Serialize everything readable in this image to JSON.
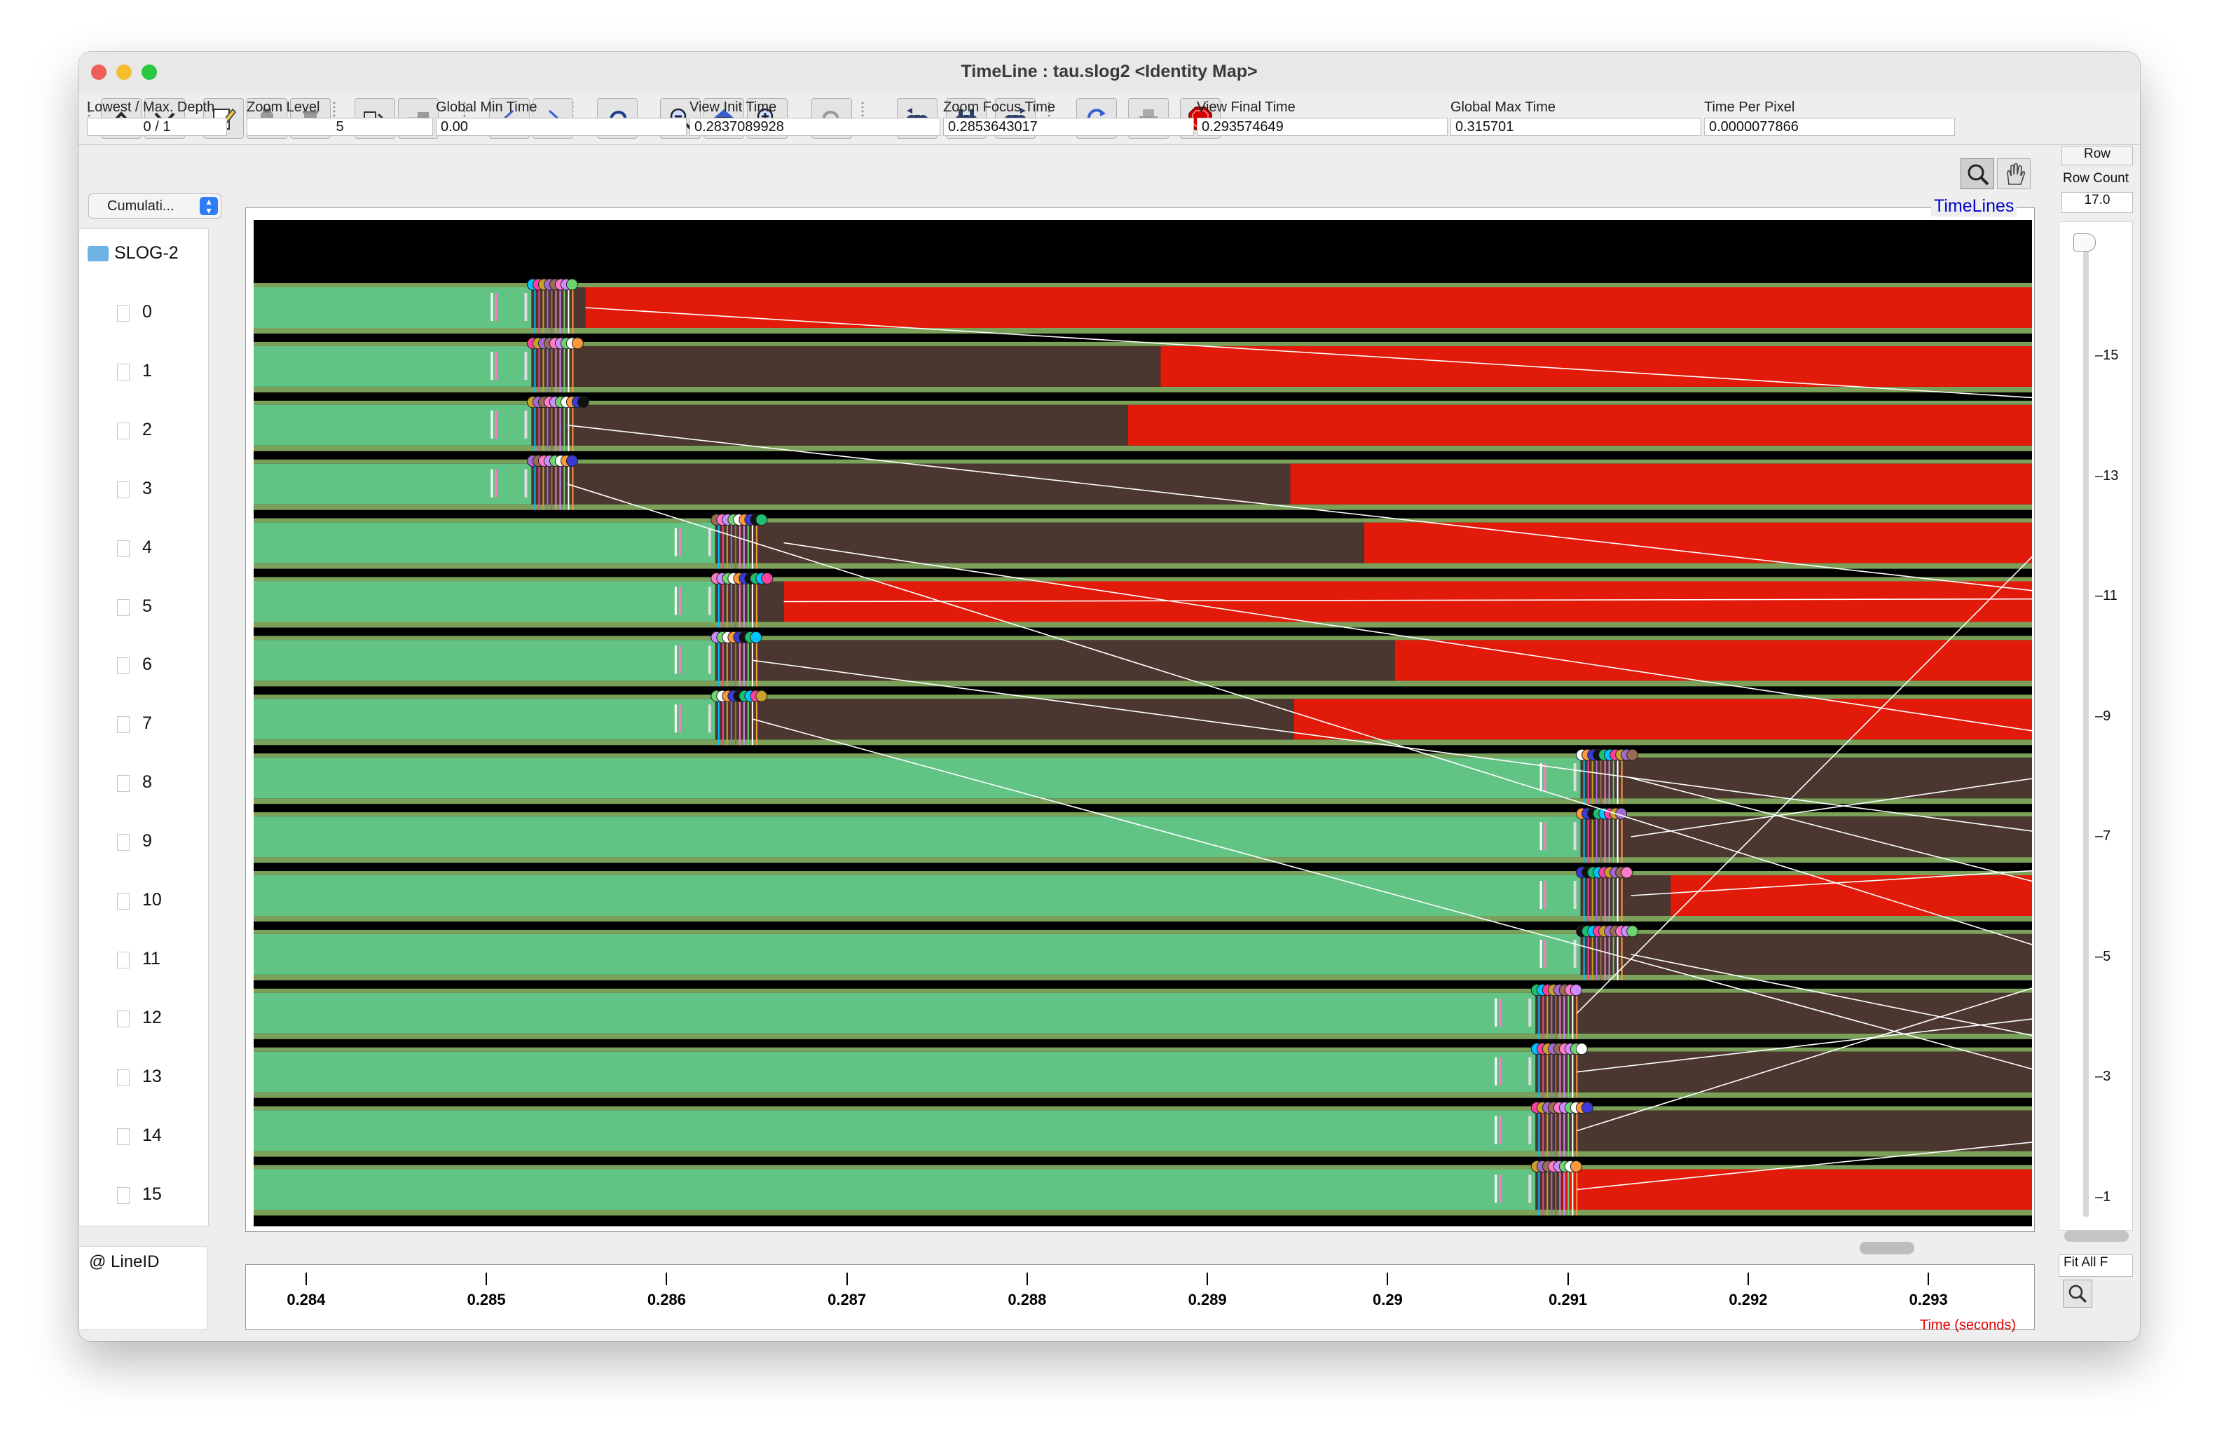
{
  "window": {
    "title": "TimeLine : tau.slog2  <Identity Map>",
    "traffic_colors": [
      "#ee5f57",
      "#f5bd2f",
      "#28c840"
    ]
  },
  "toolbar": {
    "buttons": [
      "up-icon",
      "down-icon",
      "edit-icon",
      "jar-icon",
      "delete-icon",
      "export-icon",
      "import-icon",
      "back-icon",
      "forward-icon",
      "undo-icon",
      "zoom-out-icon",
      "home-icon",
      "zoom-in-icon",
      "redo-icon",
      "search-back-icon",
      "search-icon",
      "search-forward-icon",
      "refresh-icon",
      "print-icon",
      "stop-icon"
    ]
  },
  "info": {
    "depth_label": "Lowest / Max. Depth",
    "depth_value": "0 / 1",
    "zoom_level_label": "Zoom Level",
    "zoom_level": "5",
    "global_min_label": "Global Min Time",
    "global_min": "0.00",
    "view_init_label": "View  Init Time",
    "view_init": "0.2837089928",
    "zoom_focus_label": "Zoom Focus Time",
    "zoom_focus": "0.2853643017",
    "view_final_label": "View Final Time",
    "view_final": "0.293574649",
    "global_max_label": "Global Max Time",
    "global_max": "0.315701",
    "time_per_pixel_label": "Time Per Pixel",
    "time_per_pixel": "0.0000077866"
  },
  "left": {
    "mode_select": "Cumulati...",
    "tree_root": "SLOG-2",
    "lines": [
      "0",
      "1",
      "2",
      "3",
      "4",
      "5",
      "6",
      "7",
      "8",
      "9",
      "10",
      "11",
      "12",
      "13",
      "14",
      "15"
    ],
    "footer": "@ LineID"
  },
  "canvas": {
    "header_label": "TimeLines",
    "colors": {
      "background": "#000000",
      "compute": "#61c384",
      "wait": "#4b3630",
      "red": "#e21a0a",
      "separator": "#7aa05a"
    }
  },
  "axis": {
    "ticks": [
      "0.284",
      "0.285",
      "0.286",
      "0.287",
      "0.288",
      "0.289",
      "0.29",
      "0.291",
      "0.292",
      "0.293"
    ],
    "label": "Time (seconds)"
  },
  "right": {
    "row_label": "Row",
    "row_count_label": "Row Count",
    "row_count": "17.0",
    "ruler": [
      "15",
      "13",
      "11",
      "9",
      "7",
      "5",
      "3",
      "1"
    ],
    "fit_label": "Fit All F"
  },
  "rows": [
    {
      "event": 0.28525,
      "wait_end": 0.28555,
      "red_from": 0.28555
    },
    {
      "event": 0.28525,
      "wait_end": 0.28874,
      "red_from": 0.28874
    },
    {
      "event": 0.28525,
      "wait_end": 0.28856,
      "red_from": 0.28856
    },
    {
      "event": 0.28525,
      "wait_end": 0.28946,
      "red_from": 0.28946
    },
    {
      "event": 0.28627,
      "wait_end": 0.28987,
      "red_from": 0.28987
    },
    {
      "event": 0.28627,
      "wait_end": 0.28665,
      "red_from": 0.28665
    },
    {
      "event": 0.28627,
      "wait_end": 0.29004,
      "red_from": 0.29004
    },
    {
      "event": 0.28627,
      "wait_end": 0.28948,
      "red_from": 0.28948
    },
    {
      "event": 0.29107,
      "wait_end": 0.2937,
      "red_from": null
    },
    {
      "event": 0.29107,
      "wait_end": 0.2937,
      "red_from": null
    },
    {
      "event": 0.29107,
      "wait_end": 0.29157,
      "red_from": 0.29157
    },
    {
      "event": 0.29107,
      "wait_end": 0.2937,
      "red_from": null
    },
    {
      "event": 0.29082,
      "wait_end": 0.2937,
      "red_from": null
    },
    {
      "event": 0.29082,
      "wait_end": 0.2937,
      "red_from": null
    },
    {
      "event": 0.29082,
      "wait_end": 0.2937,
      "red_from": null
    },
    {
      "event": 0.29082,
      "wait_end": 0.29097,
      "red_from": 0.29097
    }
  ]
}
